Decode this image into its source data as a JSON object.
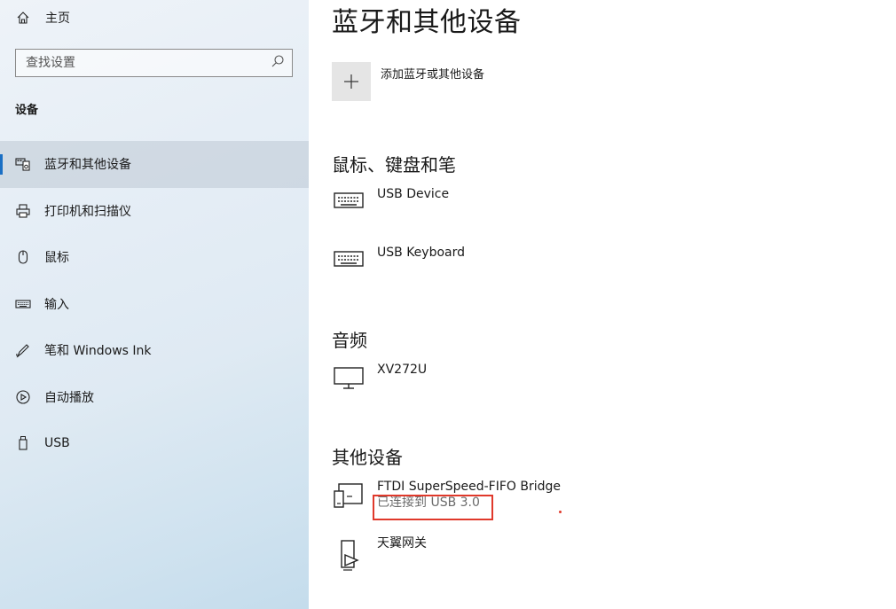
{
  "sidebar": {
    "home_label": "主页",
    "search_placeholder": "查找设置",
    "section_label": "设备",
    "items": [
      {
        "label": "蓝牙和其他设备",
        "icon": "bluetooth-devices-icon"
      },
      {
        "label": "打印机和扫描仪",
        "icon": "printer-icon"
      },
      {
        "label": "鼠标",
        "icon": "mouse-icon"
      },
      {
        "label": "输入",
        "icon": "keyboard-icon"
      },
      {
        "label": "笔和 Windows Ink",
        "icon": "pen-icon"
      },
      {
        "label": "自动播放",
        "icon": "autoplay-icon"
      },
      {
        "label": "USB",
        "icon": "usb-icon"
      }
    ],
    "active_index": 0
  },
  "main": {
    "title": "蓝牙和其他设备",
    "add_label": "添加蓝牙或其他设备",
    "groups": [
      {
        "title": "鼠标、键盘和笔",
        "devices": [
          {
            "name": "USB Device",
            "icon": "keyboard-icon"
          },
          {
            "name": "USB Keyboard",
            "icon": "keyboard-icon"
          }
        ]
      },
      {
        "title": "音频",
        "devices": [
          {
            "name": "XV272U",
            "icon": "monitor-icon"
          }
        ]
      },
      {
        "title": "其他设备",
        "devices": [
          {
            "name": "FTDI SuperSpeed-FIFO Bridge",
            "status": "已连接到 USB 3.0",
            "icon": "device-icon"
          },
          {
            "name": "天翼网关",
            "icon": "media-device-icon"
          }
        ]
      }
    ]
  },
  "colors": {
    "accent": "#1a6fc4",
    "highlight": "#e0392b"
  }
}
